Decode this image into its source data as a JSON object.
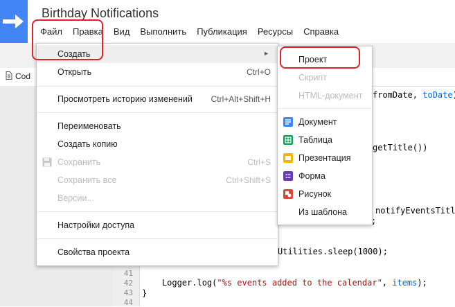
{
  "app": {
    "title": "Birthday Notifications",
    "menu": [
      "Файл",
      "Правка",
      "Вид",
      "Выполнить",
      "Публикация",
      "Ресурсы",
      "Справка"
    ]
  },
  "editor": {
    "tab_label": "Cod",
    "line_numbers": [
      "41",
      "42",
      "43",
      "44"
    ],
    "code_fragments": {
      "c1_a": "fromDate",
      "c1_b": ", ",
      "c1_c": "toDate",
      "c1_d": ");",
      "c2": "getTitle())",
      "c3": "notifyEventsTitle",
      "c4": ";",
      "c5": "Utilities.sleep(1000);",
      "c6_a": "    Logger.log(",
      "c6_b": "\"%s events added to the calendar\"",
      "c6_c": ", ",
      "c6_d": "items",
      "c6_e": ");",
      "c7": "}"
    }
  },
  "file_menu": {
    "create": "Создать",
    "open": "Открыть",
    "open_sc": "Ctrl+O",
    "history": "Просмотреть историю изменений",
    "history_sc": "Ctrl+Alt+Shift+H",
    "rename": "Переименовать",
    "copy": "Создать копию",
    "save": "Сохранить",
    "save_sc": "Ctrl+S",
    "save_all": "Сохранить все",
    "save_all_sc": "Ctrl+Shift+S",
    "versions": "Версии...",
    "access": "Настройки доступа",
    "properties": "Свойства проекта"
  },
  "create_submenu": {
    "project": "Проект",
    "script": "Скрипт",
    "html": "HTML-документ",
    "document": "Документ",
    "spreadsheet": "Таблица",
    "presentation": "Презентация",
    "form": "Форма",
    "drawing": "Рисунок",
    "template": "Из шаблона"
  },
  "colors": {
    "brand": "#4285f4",
    "doc": "#4285f4",
    "sheet": "#0f9d58",
    "slides": "#f4b400",
    "form": "#673ab7",
    "drawing": "#db4437",
    "highlight": "#e0202a"
  }
}
